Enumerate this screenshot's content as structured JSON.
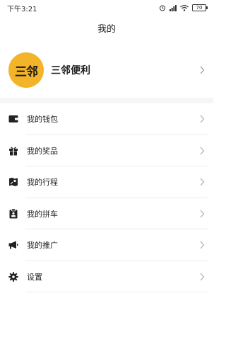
{
  "status": {
    "time": "下午3:21",
    "battery": "70"
  },
  "header": {
    "title": "我的"
  },
  "profile": {
    "avatar_text": "三邻",
    "name": "三邻便利"
  },
  "menu": [
    {
      "label": "我的钱包",
      "icon": "wallet-icon"
    },
    {
      "label": "我的奖品",
      "icon": "gift-icon"
    },
    {
      "label": "我的行程",
      "icon": "map-icon"
    },
    {
      "label": "我的拼车",
      "icon": "clipboard-icon"
    },
    {
      "label": "我的推广",
      "icon": "megaphone-icon"
    },
    {
      "label": "设置",
      "icon": "gear-icon"
    }
  ],
  "colors": {
    "accent": "#f3b42a",
    "divider": "#ececec",
    "section_gap": "#f6f6f6"
  }
}
